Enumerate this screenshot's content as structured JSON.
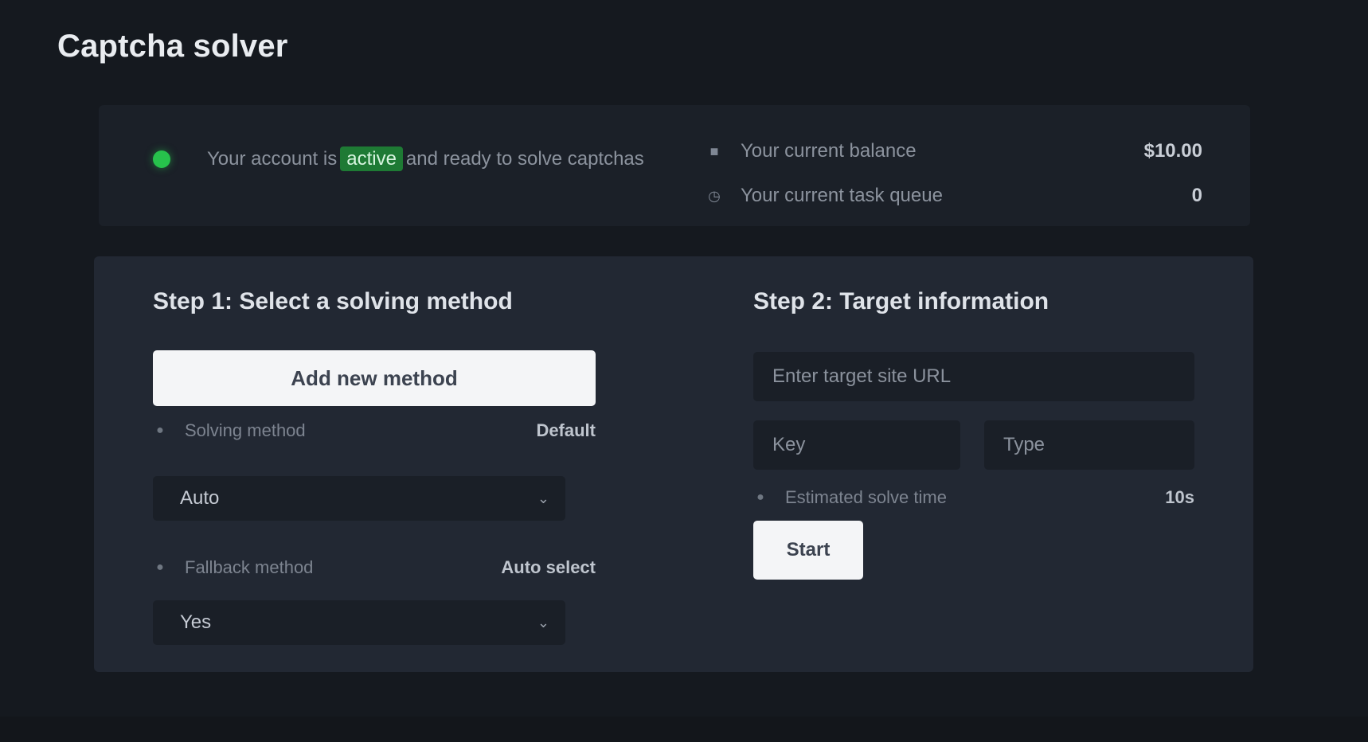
{
  "page": {
    "title": "Captcha solver"
  },
  "status": {
    "indicator_color": "#27c24c",
    "text_before": "Your account is",
    "text_highlight": "active",
    "text_after": "and ready to solve captchas",
    "info": [
      {
        "icon": "wallet-icon",
        "label": "Your current balance",
        "value": "$10.00"
      },
      {
        "icon": "clock-icon",
        "label": "Your current task queue",
        "value": "0"
      }
    ]
  },
  "step1": {
    "title": "Step 1: Select a solving method",
    "button_label": "Add new method",
    "field1": {
      "label": "Solving method",
      "value": "Default"
    },
    "select1": {
      "value": "Auto"
    },
    "field2": {
      "label": "Fallback method",
      "value": "Auto select"
    },
    "select2": {
      "value": "Yes"
    }
  },
  "step2": {
    "title": "Step 2: Target information",
    "url_input": {
      "placeholder": "Enter target site URL",
      "value": ""
    },
    "key_input": {
      "placeholder": "Key",
      "value": ""
    },
    "type_input": {
      "placeholder": "Type",
      "value": ""
    },
    "field": {
      "label": "Estimated solve time",
      "value": "10s"
    },
    "start_label": "Start"
  },
  "colors": {
    "accent": "#27c24c",
    "background": "#15191f",
    "card": "#222833",
    "button": "#f4f5f7"
  }
}
